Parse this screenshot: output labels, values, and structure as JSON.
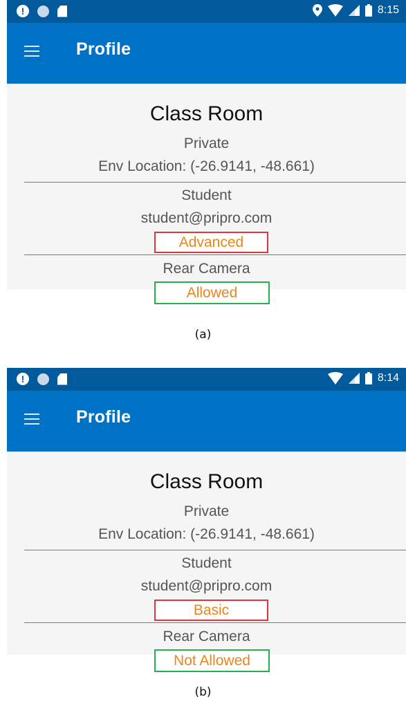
{
  "colors": {
    "status_bar": "#005a9c",
    "app_bar": "#0072c6",
    "content_bg": "#f5f5f5",
    "level_border": "#e5323a",
    "permission_border": "#22b14c",
    "highlight_text": "#e8861c"
  },
  "panels": [
    {
      "caption": "(a)",
      "status": {
        "left_icons": [
          "alert-icon",
          "dot-icon",
          "sd-card-icon"
        ],
        "right_icons": [
          "location-icon",
          "wifi-icon",
          "signal-icon",
          "battery-icon"
        ],
        "time": "8:15"
      },
      "app_bar": {
        "title": "Profile",
        "menu_icon": "hamburger-menu-icon"
      },
      "room": {
        "name": "Class Room",
        "privacy": "Private",
        "location": "Env Location: (-26.9141, -48.661)"
      },
      "user": {
        "role": "Student",
        "email": "student@pripro.com",
        "level": "Advanced"
      },
      "camera": {
        "label": "Rear Camera",
        "permission": "Allowed"
      }
    },
    {
      "caption": "(b)",
      "status": {
        "left_icons": [
          "alert-icon",
          "dot-icon",
          "sd-card-icon"
        ],
        "right_icons": [
          "wifi-icon",
          "signal-icon",
          "battery-icon"
        ],
        "time": "8:14"
      },
      "app_bar": {
        "title": "Profile",
        "menu_icon": "hamburger-menu-icon"
      },
      "room": {
        "name": "Class Room",
        "privacy": "Private",
        "location": "Env Location: (-26.9141, -48.661)"
      },
      "user": {
        "role": "Student",
        "email": "student@pripro.com",
        "level": "Basic"
      },
      "camera": {
        "label": "Rear Camera",
        "permission": "Not Allowed"
      }
    }
  ]
}
